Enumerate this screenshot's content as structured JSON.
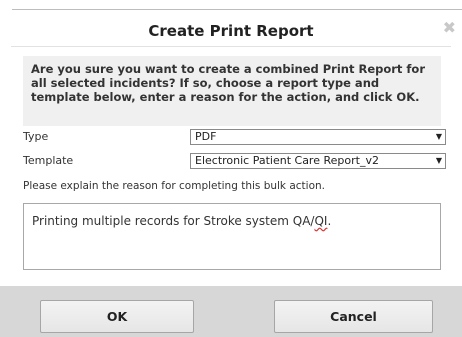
{
  "dialog": {
    "title": "Create Print Report",
    "close_glyph": "✖",
    "notice": "Are you sure you want to create a combined Print Report for all selected incidents? If so, choose a report type and template below, enter a reason for the action, and click OK.",
    "type_label": "Type",
    "type_value": "PDF",
    "template_label": "Template",
    "template_value": "Electronic Patient Care Report_v2",
    "reason_prompt": "Please explain the reason for completing this bulk action.",
    "reason_text_main": "Printing multiple records for Stroke system QA/",
    "reason_text_spell": "QI",
    "reason_text_end": ".",
    "ok_label": "OK",
    "cancel_label": "Cancel",
    "dropdown_caret": "▼"
  },
  "icons": {
    "close": "close-icon",
    "dropdown": "chevron-down-icon"
  }
}
